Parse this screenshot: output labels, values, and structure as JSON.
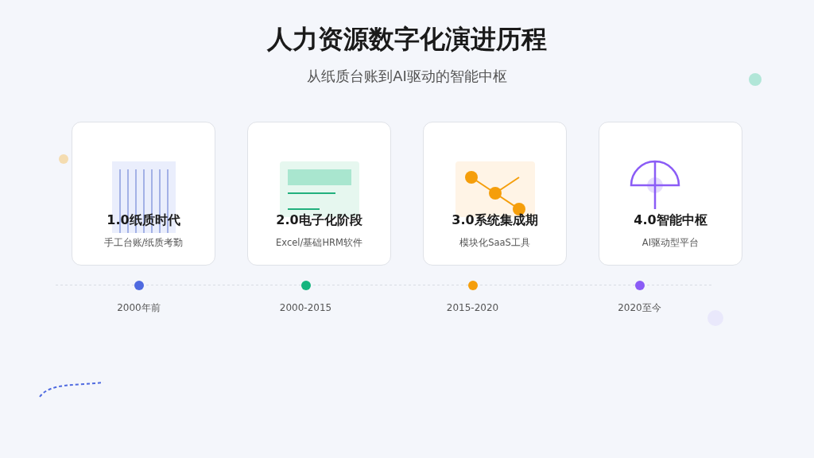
{
  "title": "人力资源数字化演进历程",
  "subtitle": "从纸质台账到AI驱动的智能中枢",
  "stages": [
    {
      "kind": "paper",
      "title": "1.0纸质时代",
      "description": "手工台账/纸质考勤",
      "period": "2000年前",
      "color": "#4f6ae0"
    },
    {
      "kind": "screen",
      "title": "2.0电子化阶段",
      "description": "Excel/基础HRM软件",
      "period": "2000-2015",
      "color": "#15b47e"
    },
    {
      "kind": "network",
      "title": "3.0系统集成期",
      "description": "模块化SaaS工具",
      "period": "2015-2020",
      "color": "#f59e0b"
    },
    {
      "kind": "hub",
      "title": "4.0智能中枢",
      "description": "AI驱动型平台",
      "period": "2020至今",
      "color": "#8b5cf6"
    }
  ]
}
